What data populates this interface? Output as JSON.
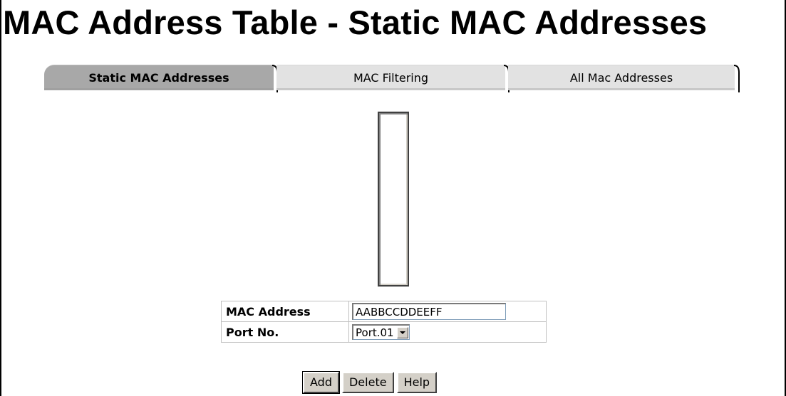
{
  "page": {
    "title": "MAC Address Table - Static MAC Addresses"
  },
  "tabs": [
    {
      "label": "Static MAC Addresses",
      "active": true
    },
    {
      "label": "MAC Filtering",
      "active": false
    },
    {
      "label": "All Mac Addresses",
      "active": false
    }
  ],
  "form": {
    "mac_address": {
      "label": "MAC Address",
      "value": "AABBCCDDEEFF"
    },
    "port_no": {
      "label": "Port No.",
      "selected": "Port.01"
    }
  },
  "buttons": {
    "add": "Add",
    "delete": "Delete",
    "help": "Help"
  },
  "icons": {
    "dropdown": "chevron-down-icon"
  },
  "colors": {
    "active_tab": "#a8a8a8",
    "inactive_tab": "#e2e2e2",
    "button": "#d4d0c8"
  }
}
